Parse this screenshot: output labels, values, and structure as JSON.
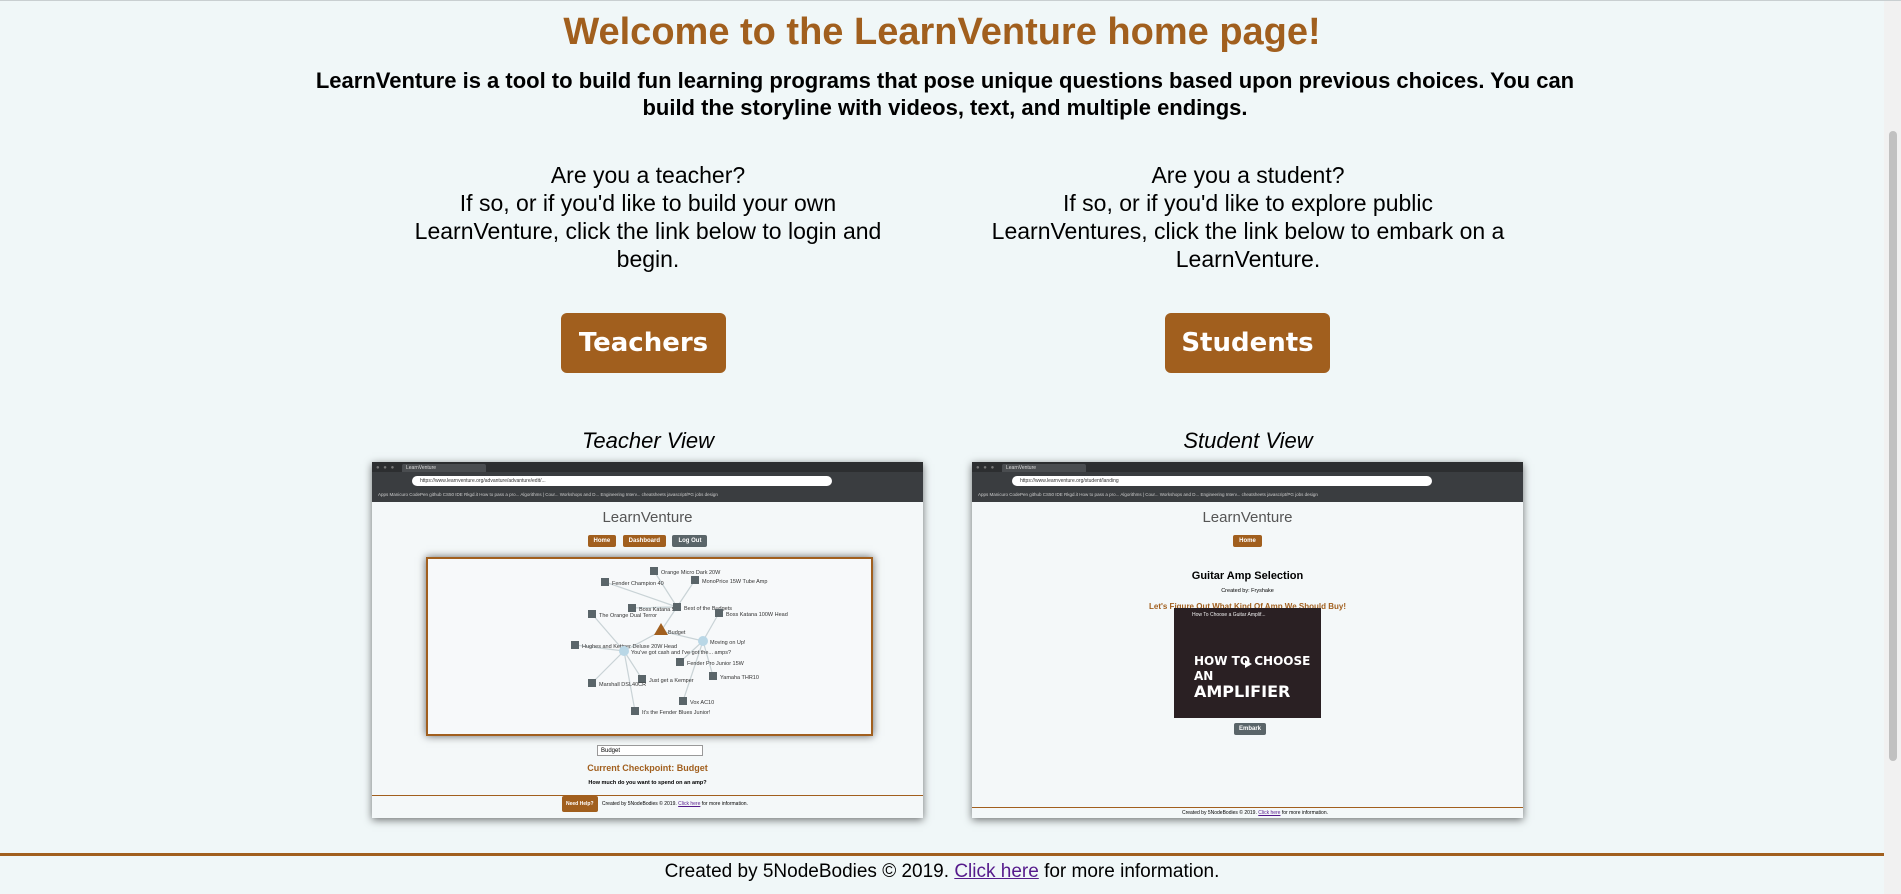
{
  "header": {
    "title": "Welcome to the LearnVenture home page!",
    "intro": "LearnVenture is a tool to build fun learning programs that pose unique questions based upon previous choices. You can build the storyline with videos, text, and multiple endings."
  },
  "teacher": {
    "question": "Are you a teacher?",
    "body": "If so, or if you'd like to build your own LearnVenture, click the link below to login and begin.",
    "button": "Teachers",
    "view_label": "Teacher View"
  },
  "student": {
    "question": "Are you a student?",
    "body": "If so, or if you'd like to explore public LearnVentures, click the link below to embark on a LearnVenture.",
    "button": "Students",
    "view_label": "Student View"
  },
  "teacher_shot": {
    "tab": "LearnVenture",
    "url": "https://www.learnventure.org/advanture/advanture/edit/...",
    "bookmarks": "Apps   Manicuro   CodePen   github   CS50 IDE   Rkgd.it   How to pass a pro...   Algorithms | Cour...   Workshops and D...   Engineering Interv...   cheatsheets   javascript/PG   jobs   design",
    "brand": "LearnVenture",
    "nav": [
      "Home",
      "Dashboard",
      "Log Out"
    ],
    "graph_labels": [
      "Orange Micro Dark 20W",
      "Fender Champion 40",
      "MonoPrice 15W Tube Amp",
      "Boss Katana 50",
      "Best of the Budgets",
      "The Orange Dual Terror",
      "Boss Katana 100W Head",
      "Budget",
      "Moving on Up!",
      "Hughes and Kettner Deluxe 20W Head",
      "You've got cash and I've got the... amps?",
      "Fender Pro Junior 15W",
      "Just get a Kemper",
      "Yamaha THR10",
      "Marshall DSL40CR",
      "Vox AC10",
      "It's the Fender Blues Junior!"
    ],
    "select_value": "Budget",
    "checkpoint": "Current Checkpoint: Budget",
    "question": "How much do you want to spend on an amp?",
    "help_button": "Need Help?",
    "footer_text": "Created by 5NodeBodies © 2019.",
    "footer_link": "Click here",
    "footer_tail": "for more information."
  },
  "student_shot": {
    "tab": "LearnVenture",
    "url": "https://www.learnventure.org/student/landing",
    "bookmarks": "Apps   Manicuro   CodePen   github   CS50 IDE   Rkgd.it   How to pass a pro...   Algorithms | Cour...   Workshops and D...   Engineering Interv...   cheatsheets   javascript/PG   jobs   design",
    "brand": "LearnVenture",
    "nav": [
      "Home"
    ],
    "title": "Guitar Amp Selection",
    "created_by": "Created by: Fryshake",
    "subtitle": "Let's Figure Out What Kind Of Amp We Should Buy!",
    "video_title": "How To Choose a Guitar Amplif...",
    "video_text_1": "HOW TO CHOOSE AN",
    "video_text_2": "AMPLIFIER",
    "embark": "Embark",
    "footer_text": "Created by 5NodeBodies © 2019.",
    "footer_link": "Click here",
    "footer_tail": "for more information."
  },
  "footer": {
    "text": "Created by 5NodeBodies © 2019.",
    "link": "Click here",
    "tail": "for more information."
  },
  "colors": {
    "accent": "#a15f1e",
    "background": "#f0f7f8",
    "gray_button": "#5a6569",
    "link": "#551a8b"
  }
}
